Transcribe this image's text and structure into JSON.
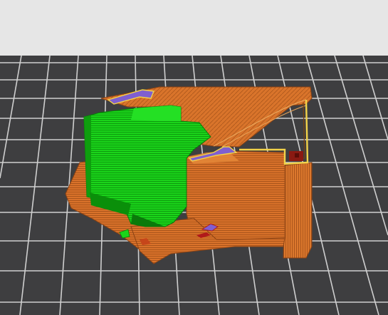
{
  "viewport": {
    "background_color": "#e6e6e6",
    "bed_color": "#3e3e40",
    "grid_line_color": "#cfcfcf"
  },
  "model": {
    "feature_colors": {
      "perimeter": "#e0782a",
      "perimeter_dark": "#b5541a",
      "infill_green": "#18d418",
      "infill_green_dark": "#0a8f0a",
      "top_layer_purple": "#7f5fd0",
      "outline_yellow": "#f2d34a",
      "solid_dark_red": "#8a1a12"
    }
  }
}
